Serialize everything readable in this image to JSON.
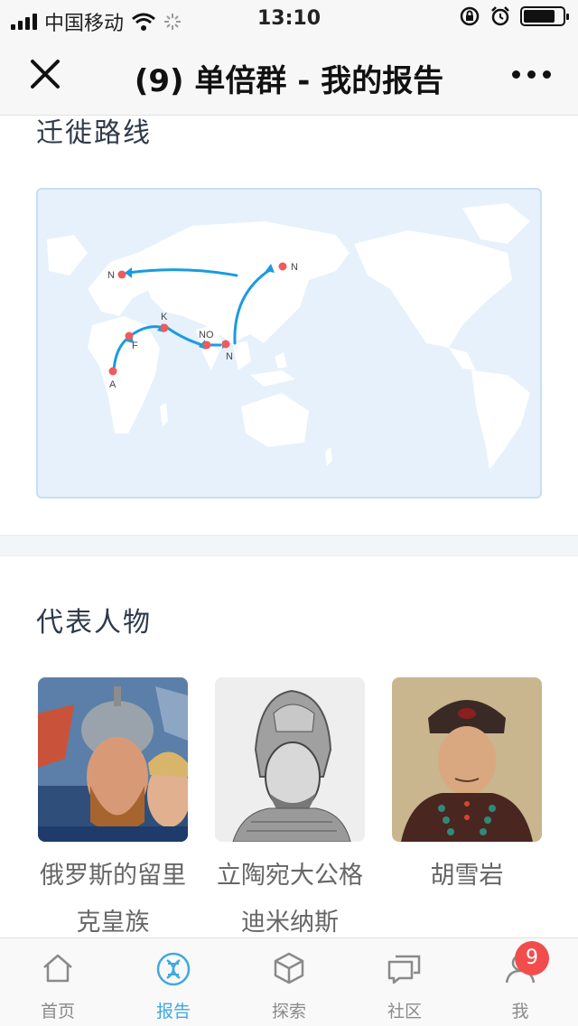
{
  "status": {
    "carrier": "中国移动",
    "time": "13:10"
  },
  "nav": {
    "title": "(9) 单倍群 - 我的报告"
  },
  "migration": {
    "title": "迁徙路线",
    "labels": [
      "A",
      "F",
      "K",
      "NO",
      "N",
      "N",
      "N"
    ],
    "accent": "#1a9be0",
    "point_color": "#f05a5a"
  },
  "people": {
    "title": "代表人物",
    "items": [
      {
        "name": "俄罗斯的留里克皇族"
      },
      {
        "name": "立陶宛大公格迪米纳斯"
      },
      {
        "name": "胡雪岩"
      }
    ]
  },
  "tabbar": {
    "tabs": [
      {
        "label": "首页",
        "icon": "home-icon"
      },
      {
        "label": "报告",
        "icon": "dna-icon"
      },
      {
        "label": "探索",
        "icon": "cube-icon"
      },
      {
        "label": "社区",
        "icon": "chat-icon"
      },
      {
        "label": "我",
        "icon": "person-icon"
      }
    ],
    "badge": "9"
  }
}
